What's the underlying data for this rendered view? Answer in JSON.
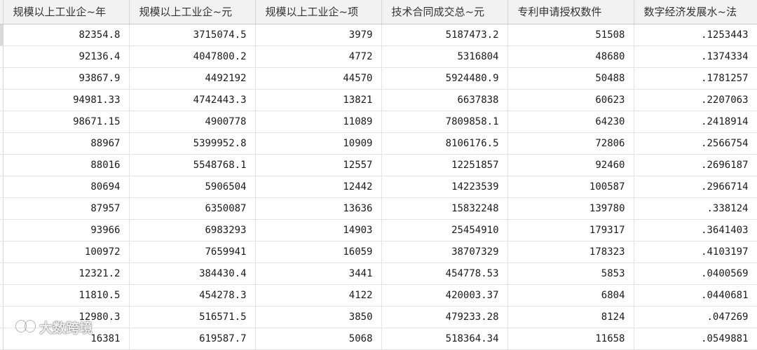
{
  "table": {
    "headers": [
      "规模以上工业企~年",
      "规模以上工业企~元",
      "规模以上工业企~项",
      "技术合同成交总~元",
      "专利申请授权数件",
      "数字经济发展水~法"
    ],
    "rows": [
      [
        "82354.8",
        "3715074.5",
        "3979",
        "5187473.2",
        "51508",
        ".1253443"
      ],
      [
        "92136.4",
        "4047800.2",
        "4772",
        "5316804",
        "48680",
        ".1374334"
      ],
      [
        "93867.9",
        "4492192",
        "44570",
        "5924480.9",
        "50488",
        ".1781257"
      ],
      [
        "94981.33",
        "4742443.3",
        "13821",
        "6637838",
        "60623",
        ".2207063"
      ],
      [
        "98671.15",
        "4900778",
        "11089",
        "7809858.1",
        "64230",
        ".2418914"
      ],
      [
        "88967",
        "5399952.8",
        "10909",
        "8106176.5",
        "72806",
        ".2566754"
      ],
      [
        "88016",
        "5548768.1",
        "12557",
        "12251857",
        "92460",
        ".2696187"
      ],
      [
        "80694",
        "5906504",
        "12442",
        "14223539",
        "100587",
        ".2966714"
      ],
      [
        "87957",
        "6350087",
        "13636",
        "15832248",
        "139780",
        ".338124"
      ],
      [
        "93966",
        "6983293",
        "14903",
        "25454910",
        "179317",
        ".3641403"
      ],
      [
        "100972",
        "7659941",
        "16059",
        "38707329",
        "178323",
        ".4103197"
      ],
      [
        "12321.2",
        "384430.4",
        "3441",
        "454778.53",
        "5853",
        ".0400569"
      ],
      [
        "11810.5",
        "454278.3",
        "4122",
        "420003.37",
        "6804",
        ".0440681"
      ],
      [
        "12980.3",
        "516571.5",
        "3850",
        "479233.28",
        "8124",
        ".047269"
      ],
      [
        "16381",
        "619587.7",
        "5068",
        "518364.34",
        "11658",
        ".0549881"
      ]
    ]
  },
  "watermark": {
    "text": "大数跨境",
    "logo_icon": "loop-logo-icon"
  }
}
